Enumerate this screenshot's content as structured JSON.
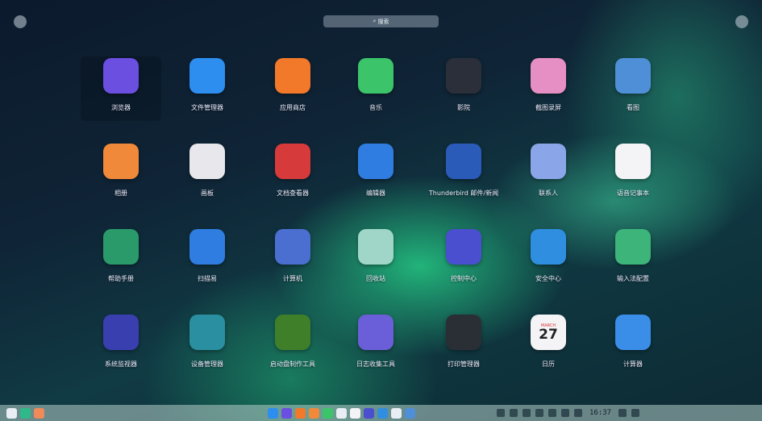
{
  "search": {
    "label": "搜索"
  },
  "apps": [
    {
      "label": "浏览器",
      "icon": "browser-icon",
      "color": "#6a4fe0"
    },
    {
      "label": "文件管理器",
      "icon": "folder-icon",
      "color": "#2d8ef0"
    },
    {
      "label": "应用商店",
      "icon": "app-store-icon",
      "color": "#f2782a"
    },
    {
      "label": "音乐",
      "icon": "music-icon",
      "color": "#3cc46a"
    },
    {
      "label": "影院",
      "icon": "movie-player-icon",
      "color": "#2a2f3a"
    },
    {
      "label": "截图录屏",
      "icon": "screenshot-camera-icon",
      "color": "#e68fc4"
    },
    {
      "label": "看图",
      "icon": "image-viewer-icon",
      "color": "#4f8fd8"
    },
    {
      "label": "相册",
      "icon": "album-icon",
      "color": "#f08a3a"
    },
    {
      "label": "画板",
      "icon": "paint-board-icon",
      "color": "#e8e8ec"
    },
    {
      "label": "文档查看器",
      "icon": "document-viewer-icon",
      "color": "#d63a3a"
    },
    {
      "label": "编辑器",
      "icon": "text-editor-icon",
      "color": "#2f7de0"
    },
    {
      "label": "Thunderbird 邮件/新闻",
      "icon": "thunderbird-icon",
      "color": "#2a5bb8"
    },
    {
      "label": "联系人",
      "icon": "contacts-icon",
      "color": "#8aa6e8"
    },
    {
      "label": "语音记事本",
      "icon": "voice-notes-icon",
      "color": "#f4f4f6"
    },
    {
      "label": "帮助手册",
      "icon": "help-manual-icon",
      "color": "#2a9a6a"
    },
    {
      "label": "扫描易",
      "icon": "scanner-icon",
      "color": "#2f7de0"
    },
    {
      "label": "计算机",
      "icon": "computer-icon",
      "color": "#4a6fd0"
    },
    {
      "label": "回收站",
      "icon": "trash-icon",
      "color": "#9fd6c8"
    },
    {
      "label": "控制中心",
      "icon": "control-center-icon",
      "color": "#4a4fd0"
    },
    {
      "label": "安全中心",
      "icon": "security-shield-icon",
      "color": "#2f8ee0"
    },
    {
      "label": "输入法配置",
      "icon": "input-method-icon",
      "color": "#3cb47a"
    },
    {
      "label": "系统监视器",
      "icon": "system-monitor-icon",
      "color": "#3a3fb0"
    },
    {
      "label": "设备管理器",
      "icon": "device-manager-icon",
      "color": "#2a8fa0"
    },
    {
      "label": "启动盘制作工具",
      "icon": "boot-disk-icon",
      "color": "#3f7f2a"
    },
    {
      "label": "日志收集工具",
      "icon": "log-collector-icon",
      "color": "#6a5fd8"
    },
    {
      "label": "打印管理器",
      "icon": "printer-icon",
      "color": "#2a2f36"
    },
    {
      "label": "日历",
      "icon": "calendar-icon",
      "color": "#f4f4f6"
    },
    {
      "label": "计算器",
      "icon": "calculator-icon",
      "color": "#3a8ee8"
    }
  ],
  "calendar_icon": {
    "month": "MARCH",
    "day": "27"
  },
  "taskbar": {
    "left": [
      {
        "icon": "launcher-icon",
        "color": "#e8eef4"
      },
      {
        "icon": "multitask-view-icon",
        "color": "#2fb88a"
      },
      {
        "icon": "desktop-icon",
        "color": "#f08a5a"
      }
    ],
    "center": [
      {
        "icon": "file-manager-icon",
        "color": "#2d8ef0"
      },
      {
        "icon": "browser-icon",
        "color": "#6a4fe0"
      },
      {
        "icon": "app-store-icon",
        "color": "#f2782a"
      },
      {
        "icon": "album-icon",
        "color": "#f08a3a"
      },
      {
        "icon": "music-icon",
        "color": "#3cc46a"
      },
      {
        "icon": "document-viewer-icon",
        "color": "#e8eef4"
      },
      {
        "icon": "calendar-icon",
        "color": "#f4f4f6"
      },
      {
        "icon": "control-center-icon",
        "color": "#4a4fd0"
      },
      {
        "icon": "security-shield-icon",
        "color": "#2f8ee0"
      },
      {
        "icon": "trash-icon",
        "color": "#e8eef4"
      },
      {
        "icon": "image-viewer-icon",
        "color": "#4f8fd8"
      }
    ],
    "tray": [
      "network-icon",
      "keyboard-icon",
      "usb-icon",
      "volume-icon",
      "wifi-icon",
      "notification-icon",
      "battery-icon"
    ],
    "clock": {
      "time": "16:37"
    },
    "right": [
      "assistant-icon",
      "trash-bin-icon"
    ]
  }
}
